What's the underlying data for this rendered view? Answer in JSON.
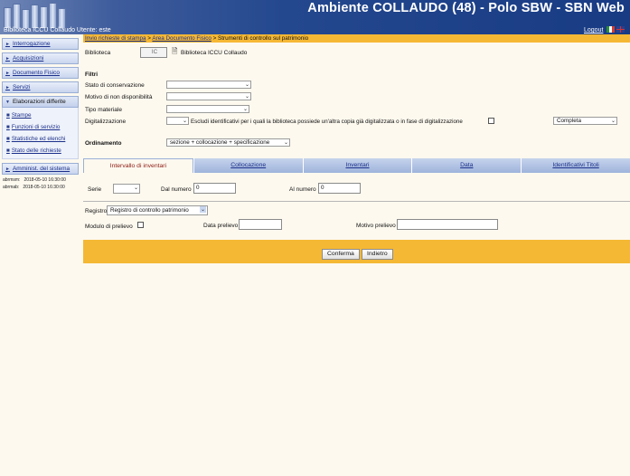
{
  "header": {
    "title": "Ambiente COLLAUDO (48) - Polo SBW - SBN Web",
    "user_line": "Biblioteca ICCU Collaudo Utente: este",
    "logout": "Logout",
    "flags": [
      "it-flag-icon",
      "uk-flag-icon"
    ]
  },
  "sidebar": {
    "items": [
      {
        "label": "Interrogazione"
      },
      {
        "label": "Acquisizioni"
      },
      {
        "label": "Documento Fisico"
      },
      {
        "label": "Servizi"
      },
      {
        "label": "Elaborazioni differite"
      }
    ],
    "subitems": [
      {
        "label": "Stampe"
      },
      {
        "label": "Funzioni di servizio"
      },
      {
        "label": "Statistiche ed elenchi"
      },
      {
        "label": "Stato delle richieste"
      }
    ],
    "admin": "Amminist. del sistema",
    "log": [
      {
        "key": "abrmsm:",
        "value": "2018-05-10 16:30:00"
      },
      {
        "key": "abrmab:",
        "value": "2018-05-10 16:30:00"
      }
    ]
  },
  "breadcrumb": {
    "part1": "Invio richieste di stampa",
    "sep": " > ",
    "part2": "Area Documento Fisico",
    "part3": "Strumenti di controllo sul patrimonio"
  },
  "form": {
    "biblioteca_label": "Biblioteca",
    "biblioteca_code": "IC",
    "biblioteca_name": "Biblioteca ICCU Collaudo",
    "filtri_title": "Filtri",
    "stato_conservazione": "Stato di conservazione",
    "motivo_non_disp": "Motivo di non disponibilità",
    "tipo_materiale": "Tipo materiale",
    "digitalizzazione": "Digitalizzazione",
    "escludi_text": "Escludi identificativi per i quali la biblioteca possiede un'altra copia già digitalizzata o in fase di digitalizzazione",
    "completa_value": "Completa",
    "ordinamento_label": "Ordinamento",
    "ordinamento_value": "sezione + collocazione + specificazione"
  },
  "tabs": [
    {
      "label": "Intervallo di inventari"
    },
    {
      "label": "Collocazione"
    },
    {
      "label": "Inventari"
    },
    {
      "label": "Data"
    },
    {
      "label": "Identificativi Titoli"
    }
  ],
  "tab_content": {
    "serie_label": "Serie",
    "dal_numero_label": "Dal numero",
    "dal_numero_value": "0",
    "al_numero_label": "Al numero",
    "al_numero_value": "0",
    "registro_label": "Registro",
    "registro_value": "Registro di controllo patrimonio",
    "modulo_prelievo_label": "Modulo di prelievo",
    "data_prelievo_label": "Data prelievo",
    "motivo_prelievo_label": "Motivo prelievo"
  },
  "actions": {
    "conferma": "Conferma",
    "indietro": "Indietro"
  }
}
